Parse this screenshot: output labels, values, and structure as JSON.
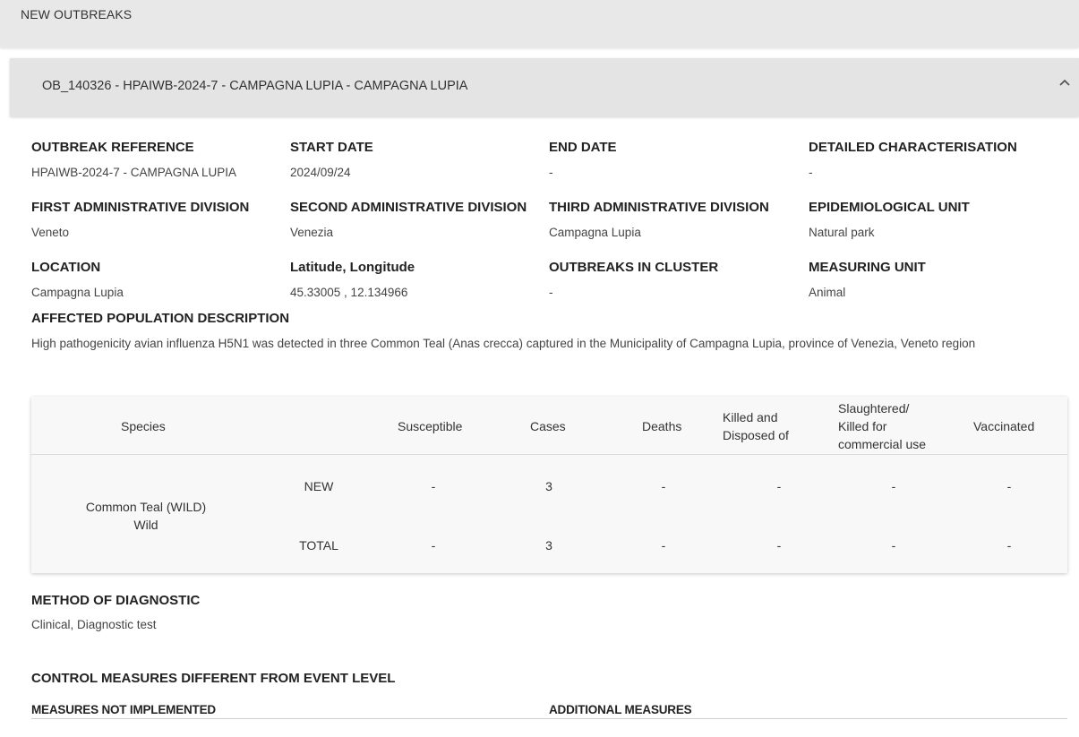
{
  "header": {
    "title": "NEW OUTBREAKS"
  },
  "panel": {
    "title": "OB_140326 - HPAIWB-2024-7 - CAMPAGNA LUPIA - CAMPAGNA LUPIA"
  },
  "fields": {
    "outbreak_reference": {
      "label": "OUTBREAK REFERENCE",
      "value": "HPAIWB-2024-7 - CAMPAGNA LUPIA"
    },
    "start_date": {
      "label": "START DATE",
      "value": "2024/09/24"
    },
    "end_date": {
      "label": "END DATE",
      "value": "-"
    },
    "detailed_characterisation": {
      "label": "DETAILED CHARACTERISATION",
      "value": "-"
    },
    "first_admin": {
      "label": "FIRST ADMINISTRATIVE DIVISION",
      "value": "Veneto"
    },
    "second_admin": {
      "label": "SECOND ADMINISTRATIVE DIVISION",
      "value": "Venezia"
    },
    "third_admin": {
      "label": "THIRD ADMINISTRATIVE DIVISION",
      "value": "Campagna Lupia"
    },
    "epi_unit": {
      "label": "EPIDEMIOLOGICAL UNIT",
      "value": "Natural park"
    },
    "location": {
      "label": "LOCATION",
      "value": "Campagna Lupia"
    },
    "lat_lon": {
      "label": "Latitude, Longitude",
      "value": "45.33005 , 12.134966"
    },
    "outbreaks_cluster": {
      "label": "OUTBREAKS IN CLUSTER",
      "value": "-"
    },
    "measuring_unit": {
      "label": "MEASURING UNIT",
      "value": "Animal"
    }
  },
  "population": {
    "label": "AFFECTED POPULATION DESCRIPTION",
    "text": "High pathogenicity avian influenza H5N1 was detected in three Common Teal (Anas crecca) captured in the Municipality of Campagna Lupia, province of Venezia, Veneto region"
  },
  "table": {
    "headers": {
      "species": "Species",
      "susceptible": "Susceptible",
      "cases": "Cases",
      "deaths": "Deaths",
      "killed_l1": "Killed and",
      "killed_l2": "Disposed of",
      "slaughtered_l1": "Slaughtered/",
      "slaughtered_l2": "Killed for",
      "slaughtered_l3": "commercial use",
      "vaccinated": "Vaccinated"
    },
    "species_l1": "Common Teal (WILD)",
    "species_l2": "Wild",
    "rows": [
      {
        "type": "NEW",
        "susceptible": "-",
        "cases": "3",
        "deaths": "-",
        "killed": "-",
        "slaughtered": "-",
        "vaccinated": "-"
      },
      {
        "type": "TOTAL",
        "susceptible": "-",
        "cases": "3",
        "deaths": "-",
        "killed": "-",
        "slaughtered": "-",
        "vaccinated": "-"
      }
    ]
  },
  "diagnostic": {
    "label": "METHOD OF DIAGNOSTIC",
    "value": "Clinical, Diagnostic test"
  },
  "control": {
    "label": "CONTROL MEASURES DIFFERENT FROM EVENT LEVEL",
    "not_implemented": "MEASURES NOT IMPLEMENTED",
    "additional": "ADDITIONAL MEASURES"
  }
}
